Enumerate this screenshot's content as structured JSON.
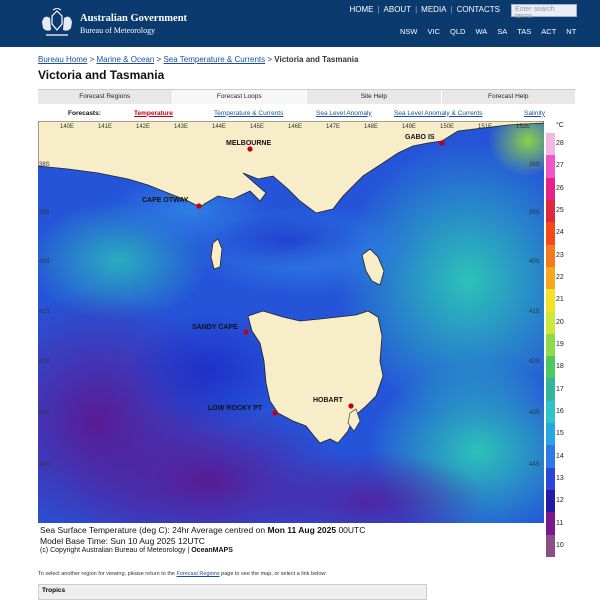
{
  "header": {
    "gov_line1": "Australian Government",
    "gov_line2": "Bureau of Meteorology",
    "top_links": [
      "HOME",
      "ABOUT",
      "MEDIA",
      "CONTACTS"
    ],
    "search_placeholder": "Enter search terms",
    "states": [
      "NSW",
      "VIC",
      "QLD",
      "WA",
      "SA",
      "TAS",
      "ACT",
      "NT"
    ]
  },
  "breadcrumb": {
    "items": [
      "Bureau Home",
      "Marine & Ocean",
      "Sea Temperature & Currents"
    ],
    "current": "Victoria and Tasmania",
    "sep": ">"
  },
  "page_title": "Victoria and Tasmania",
  "tabs": [
    "Forecast Regions",
    "Forecast Loops",
    "Site Help",
    "Forecast Help"
  ],
  "active_tab": "Forecast Loops",
  "forecasts": {
    "label": "Forecasts:",
    "links": [
      "Temperature",
      "Temperature & Currents",
      "Sea Level Anomaly",
      "Sea Level Anomaly & Currents",
      "Salinity"
    ],
    "active": "Temperature"
  },
  "map": {
    "lon_labels": [
      "140E",
      "141E",
      "142E",
      "143E",
      "144E",
      "145E",
      "146E",
      "147E",
      "148E",
      "149E",
      "150E",
      "151E",
      "152E"
    ],
    "lat_labels": [
      "38S",
      "39S",
      "40S",
      "41S",
      "42S",
      "43S",
      "44S"
    ],
    "places": [
      {
        "name": "MELBOURNE"
      },
      {
        "name": "GABO IS"
      },
      {
        "name": "CAPE OTWAY"
      },
      {
        "name": "SANDY CAPE"
      },
      {
        "name": "HOBART"
      },
      {
        "name": "LOW ROCKY PT"
      }
    ],
    "colors": {
      "land": "#f7edc8",
      "coast": "#222222",
      "marker": "#c0000c"
    }
  },
  "colorbar": {
    "unit": "°C",
    "ticks": [
      "28",
      "27",
      "26",
      "25",
      "24",
      "23",
      "22",
      "21",
      "20",
      "19",
      "18",
      "17",
      "16",
      "15",
      "14",
      "13",
      "12",
      "11",
      "10"
    ],
    "colors": [
      "#f2b8e4",
      "#ee56c7",
      "#e8218a",
      "#e0283c",
      "#f5491d",
      "#f6781f",
      "#f7a71e",
      "#f5e02a",
      "#cde83b",
      "#8fd94d",
      "#4ec860",
      "#33b79a",
      "#2ec5c9",
      "#27a6e4",
      "#2f79e6",
      "#2a45d9",
      "#241aa8",
      "#7c188d",
      "#8d4d86"
    ]
  },
  "caption": {
    "line1_prefix": "Sea Surface Temperature (deg C): 24hr Average centred on ",
    "line1_date": "Mon 11 Aug 2025",
    "line1_suffix": " 00UTC",
    "line2": "Model Base Time: Sun 10 Aug 2025 12UTC",
    "copyright": "(c) Copyright Australian Bureau of Meteorology | ",
    "brand": "OceanMAPS"
  },
  "select_note": {
    "prefix": "To select another region for viewing, please return to the ",
    "link": "Forecast Regions",
    "suffix": " page to see the map, or select a link below:"
  },
  "regions_table": {
    "header": "Tropics"
  }
}
